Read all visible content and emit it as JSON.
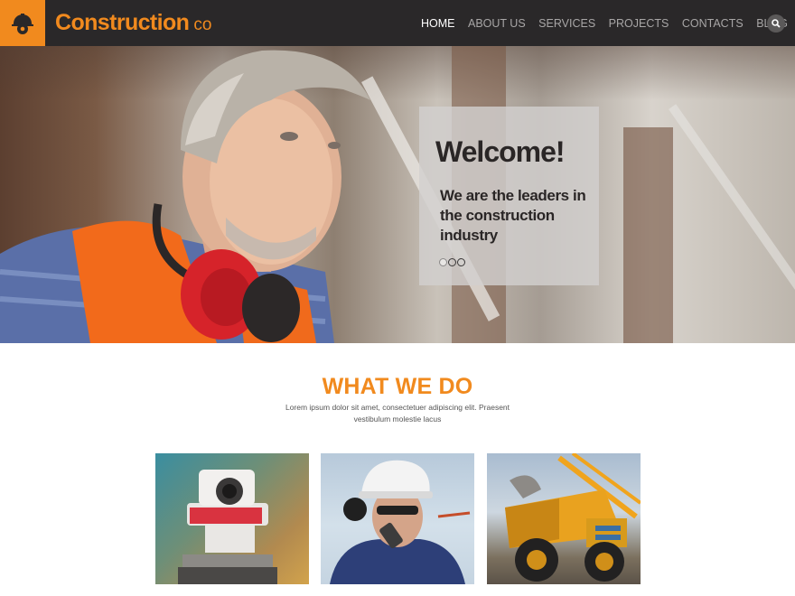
{
  "header": {
    "brand_main": "Construction",
    "brand_sub": "co",
    "logo_icon": "hard-hat-gear-icon",
    "nav": [
      {
        "label": "HOME",
        "active": true
      },
      {
        "label": "ABOUT US",
        "active": false
      },
      {
        "label": "SERVICES",
        "active": false
      },
      {
        "label": "PROJECTS",
        "active": false
      },
      {
        "label": "CONTACTS",
        "active": false
      },
      {
        "label": "BLOG",
        "active": false
      }
    ],
    "search_icon": "search-icon"
  },
  "hero": {
    "title": "Welcome!",
    "text": "We are the leaders in the construction industry",
    "slides": 3,
    "active_slide": 1
  },
  "what_we_do": {
    "title": "WHAT WE DO",
    "text": "Lorem ipsum dolor sit amet, consectetuer adipiscing elit. Praesent vestibulum molestie lacus"
  },
  "colors": {
    "accent": "#f18a1e",
    "header_bg": "#2a2829",
    "nav_text": "#a8a6a6",
    "nav_active": "#ffffff"
  }
}
